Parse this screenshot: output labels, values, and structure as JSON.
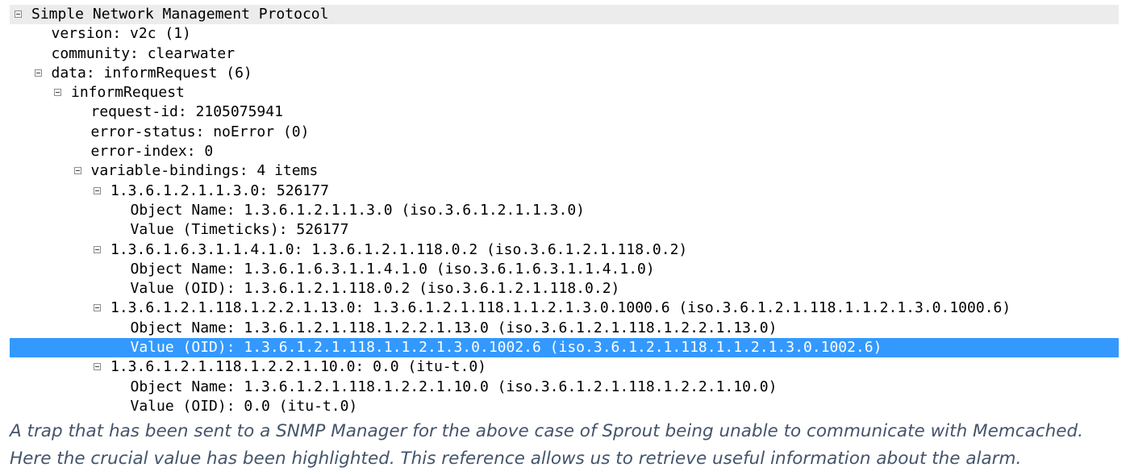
{
  "packet_details": {
    "selected_row": 17,
    "rows": [
      {
        "level": 0,
        "expander": true,
        "text": "Simple Network Management Protocol"
      },
      {
        "level": 1,
        "expander": false,
        "text": "version: v2c (1)"
      },
      {
        "level": 1,
        "expander": false,
        "text": "community: clearwater"
      },
      {
        "level": 1,
        "expander": true,
        "text": "data: informRequest (6)"
      },
      {
        "level": 2,
        "expander": true,
        "text": "informRequest"
      },
      {
        "level": 3,
        "expander": false,
        "text": "request-id: 2105075941"
      },
      {
        "level": 3,
        "expander": false,
        "text": "error-status: noError (0)"
      },
      {
        "level": 3,
        "expander": false,
        "text": "error-index: 0"
      },
      {
        "level": 3,
        "expander": true,
        "text": "variable-bindings: 4 items"
      },
      {
        "level": 4,
        "expander": true,
        "text": "1.3.6.1.2.1.1.3.0: 526177"
      },
      {
        "level": 5,
        "expander": false,
        "text": "Object Name: 1.3.6.1.2.1.1.3.0 (iso.3.6.1.2.1.1.3.0)"
      },
      {
        "level": 5,
        "expander": false,
        "text": "Value (Timeticks): 526177"
      },
      {
        "level": 4,
        "expander": true,
        "text": "1.3.6.1.6.3.1.1.4.1.0: 1.3.6.1.2.1.118.0.2 (iso.3.6.1.2.1.118.0.2)"
      },
      {
        "level": 5,
        "expander": false,
        "text": "Object Name: 1.3.6.1.6.3.1.1.4.1.0 (iso.3.6.1.6.3.1.1.4.1.0)"
      },
      {
        "level": 5,
        "expander": false,
        "text": "Value (OID): 1.3.6.1.2.1.118.0.2 (iso.3.6.1.2.1.118.0.2)"
      },
      {
        "level": 4,
        "expander": true,
        "text": "1.3.6.1.2.1.118.1.2.2.1.13.0: 1.3.6.1.2.1.118.1.1.2.1.3.0.1000.6 (iso.3.6.1.2.1.118.1.1.2.1.3.0.1000.6)"
      },
      {
        "level": 5,
        "expander": false,
        "text": "Object Name: 1.3.6.1.2.1.118.1.2.2.1.13.0 (iso.3.6.1.2.1.118.1.2.2.1.13.0)"
      },
      {
        "level": 5,
        "expander": false,
        "text": "Value (OID): 1.3.6.1.2.1.118.1.1.2.1.3.0.1002.6 (iso.3.6.1.2.1.118.1.1.2.1.3.0.1002.6)"
      },
      {
        "level": 4,
        "expander": true,
        "text": "1.3.6.1.2.1.118.1.2.2.1.10.0: 0.0 (itu-t.0)"
      },
      {
        "level": 5,
        "expander": false,
        "text": "Object Name: 1.3.6.1.2.1.118.1.2.2.1.10.0 (iso.3.6.1.2.1.118.1.2.2.1.10.0)"
      },
      {
        "level": 5,
        "expander": false,
        "text": "Value (OID): 0.0 (itu-t.0)"
      }
    ]
  },
  "caption": {
    "line1": "A trap that has been sent to a SNMP Manager for the above case of Sprout being unable to communicate with Memcached.",
    "line2": "Here the crucial value has been highlighted. This reference allows us to retrieve useful information about the alarm."
  },
  "colors": {
    "selection": "#3399ff",
    "header_band": "#ececec",
    "caption_text": "#44546a"
  },
  "icons": {
    "expander": "collapse-box-icon"
  }
}
